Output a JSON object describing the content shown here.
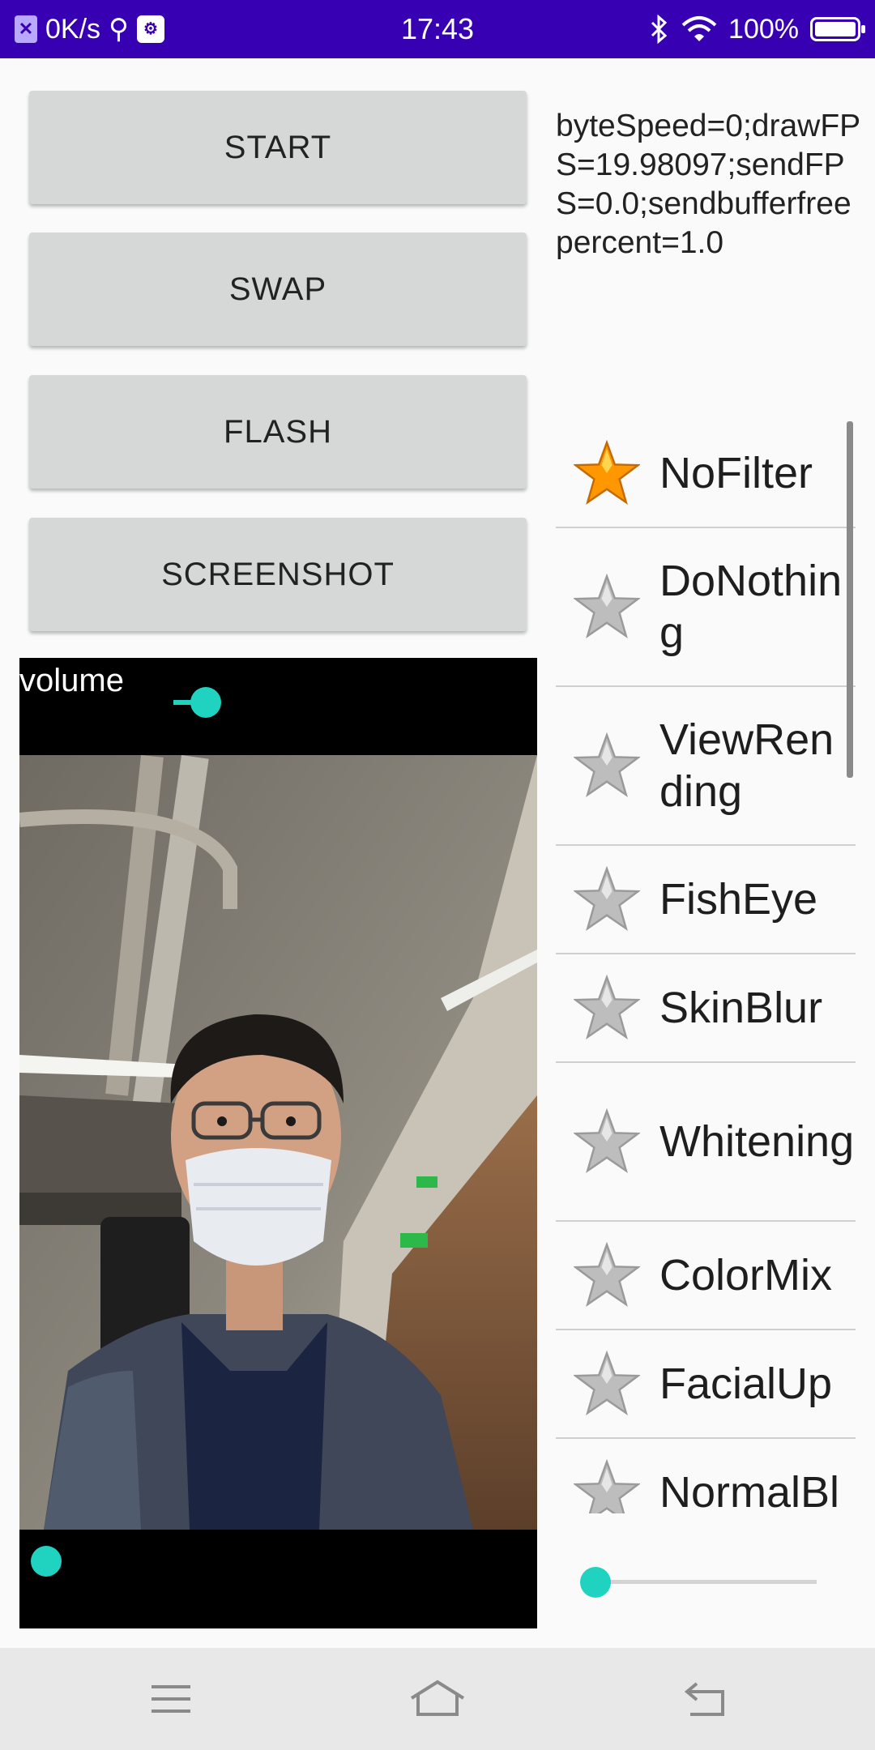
{
  "status_bar": {
    "net_speed": "0K/s",
    "time": "17:43",
    "battery": "100%",
    "icons": [
      "app-notification-icon",
      "usb-icon",
      "usb-debug-icon",
      "bluetooth-icon",
      "wifi-icon",
      "battery-icon"
    ]
  },
  "buttons": {
    "start": "START",
    "swap": "SWAP",
    "flash": "FLASH",
    "screenshot": "SCREENSHOT"
  },
  "stats_text": "byteSpeed=0;drawFPS=19.98097;sendFPS=0.0;sendbufferfreepercent=1.0",
  "preview": {
    "volume_label": "volume"
  },
  "filters": [
    {
      "label": "NoFilter",
      "selected": true
    },
    {
      "label": "DoNothing",
      "selected": false
    },
    {
      "label": "ViewRending",
      "selected": false
    },
    {
      "label": "FishEye",
      "selected": false
    },
    {
      "label": "SkinBlur",
      "selected": false
    },
    {
      "label": "Whitening",
      "selected": false
    },
    {
      "label": "ColorMix",
      "selected": false
    },
    {
      "label": "FacialUp",
      "selected": false
    },
    {
      "label": "NormalBl",
      "selected": false
    }
  ],
  "colors": {
    "status_bar": "#3700b3",
    "accent": "#1fd3c0",
    "button_bg": "#d6d7d7",
    "star_selected": "#ff9800",
    "star_unselected": "#bdbdbd"
  },
  "sliders": {
    "volume_level": 1.0,
    "preview_bottom_level": 0.0,
    "filter_intensity_level": 0.0
  },
  "nav_bar": {
    "icons": [
      "menu-icon",
      "home-icon",
      "back-icon"
    ]
  }
}
